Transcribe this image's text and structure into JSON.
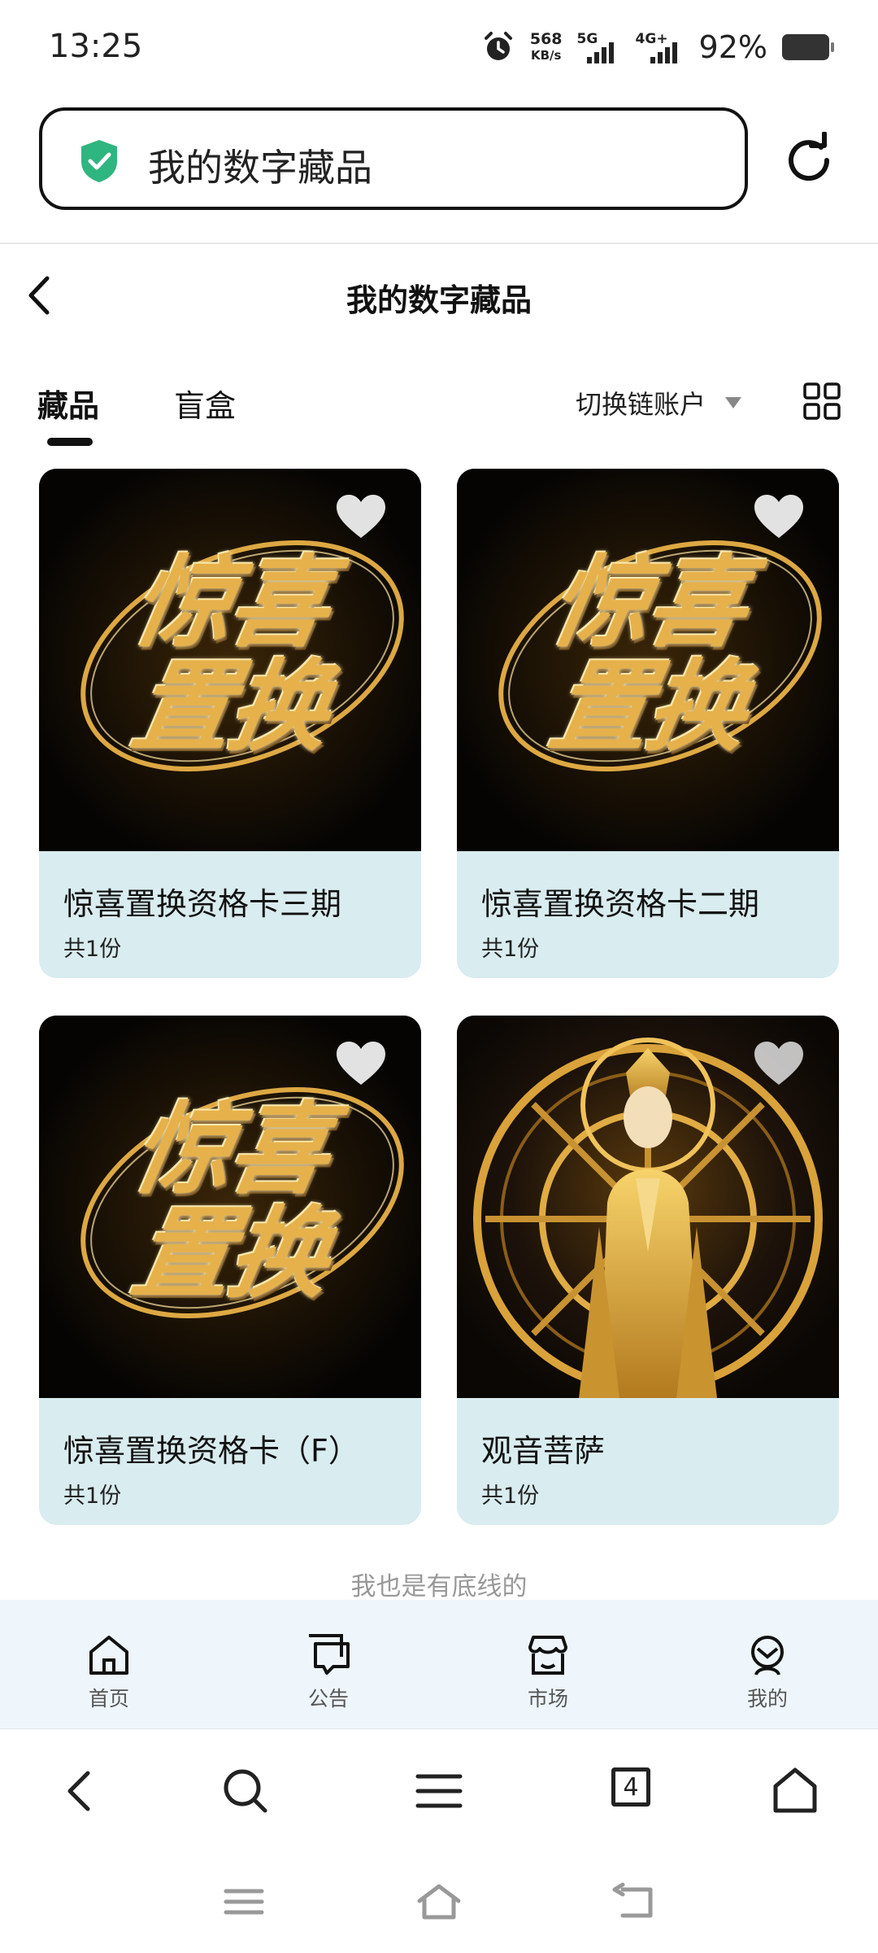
{
  "status_bar": {
    "time": "13:25",
    "net_speed_value": "568",
    "net_speed_unit": "KB/s",
    "sim1_label": "5G",
    "sim2_label": "4G+",
    "battery_percent": "92%"
  },
  "address_bar": {
    "title": "我的数字藏品",
    "icons": {
      "security": "shield-check-icon",
      "reload": "refresh-icon"
    },
    "colors": {
      "shield": "#2fb57f"
    }
  },
  "page": {
    "title": "我的数字藏品"
  },
  "tabs": [
    {
      "label": "藏品",
      "active": true
    },
    {
      "label": "盲盒",
      "active": false
    }
  ],
  "account_switch": {
    "label": "切换链账户"
  },
  "collectibles": [
    {
      "name": "惊喜置换资格卡三期",
      "count": "共1份",
      "art_text": [
        "惊喜",
        "置换"
      ],
      "image": "gold-title-art"
    },
    {
      "name": "惊喜置换资格卡二期",
      "count": "共1份",
      "art_text": [
        "惊喜",
        "置换"
      ],
      "image": "gold-title-art"
    },
    {
      "name": "惊喜置换资格卡（F）",
      "count": "共1份",
      "art_text": [
        "惊喜",
        "置换"
      ],
      "image": "gold-title-art"
    },
    {
      "name": "观音菩萨",
      "count": "共1份",
      "image": "golden-guanyin-statue"
    }
  ],
  "footer_note": "我也是有底线的",
  "app_nav": [
    {
      "label": "首页",
      "icon": "home-icon"
    },
    {
      "label": "公告",
      "icon": "announcement-icon"
    },
    {
      "label": "市场",
      "icon": "store-icon"
    },
    {
      "label": "我的",
      "icon": "profile-icon"
    }
  ],
  "browser_toolbar": {
    "tab_count": "4"
  },
  "colors": {
    "card_background": "#d9ecef",
    "app_nav_background": "#eef6fb",
    "art_gold": "#e6b14b"
  }
}
